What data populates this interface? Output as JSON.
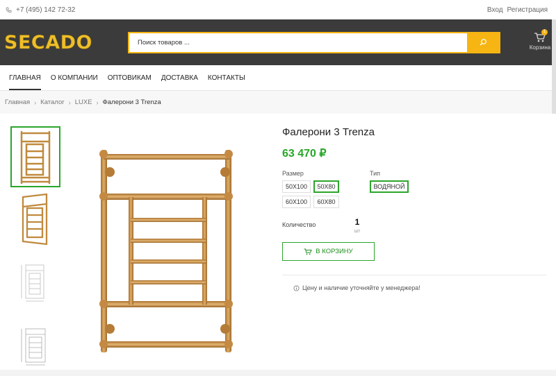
{
  "topbar": {
    "phone": "+7 (495) 142 72-32",
    "login": "Вход",
    "register": "Регистрация",
    "phone_icon": "phone-icon"
  },
  "header": {
    "logo": "SECADO",
    "search_placeholder": "Поиск товаров ...",
    "cart_label": "Корзина",
    "cart_count": "1",
    "brand_color": "#f6b513"
  },
  "nav": {
    "items": [
      {
        "label": "ГЛАВНАЯ"
      },
      {
        "label": "О КОМПАНИИ"
      },
      {
        "label": "ОПТОВИКАМ"
      },
      {
        "label": "ДОСТАВКА"
      },
      {
        "label": "КОНТАКТЫ"
      }
    ]
  },
  "breadcrumb": {
    "items": [
      "Главная",
      "Каталог",
      "LUXE"
    ],
    "current": "Фалерони 3 Trenza"
  },
  "product": {
    "title": "Фалерони 3 Trenza",
    "price": "63 470 ₽",
    "size_label": "Размер",
    "sizes": [
      "50X100",
      "50X80",
      "60X100",
      "60X80"
    ],
    "selected_size": "50X80",
    "type_label": "Тип",
    "types": [
      "ВОДЯНОЙ"
    ],
    "selected_type": "ВОДЯНОЙ",
    "qty_label": "Количество",
    "qty_value": "1",
    "qty_unit": "шт",
    "add_to_cart": "В КОРЗИНУ",
    "note": "Цену и наличие уточняйте у менеджера!",
    "accent_color": "#2aa52a"
  }
}
